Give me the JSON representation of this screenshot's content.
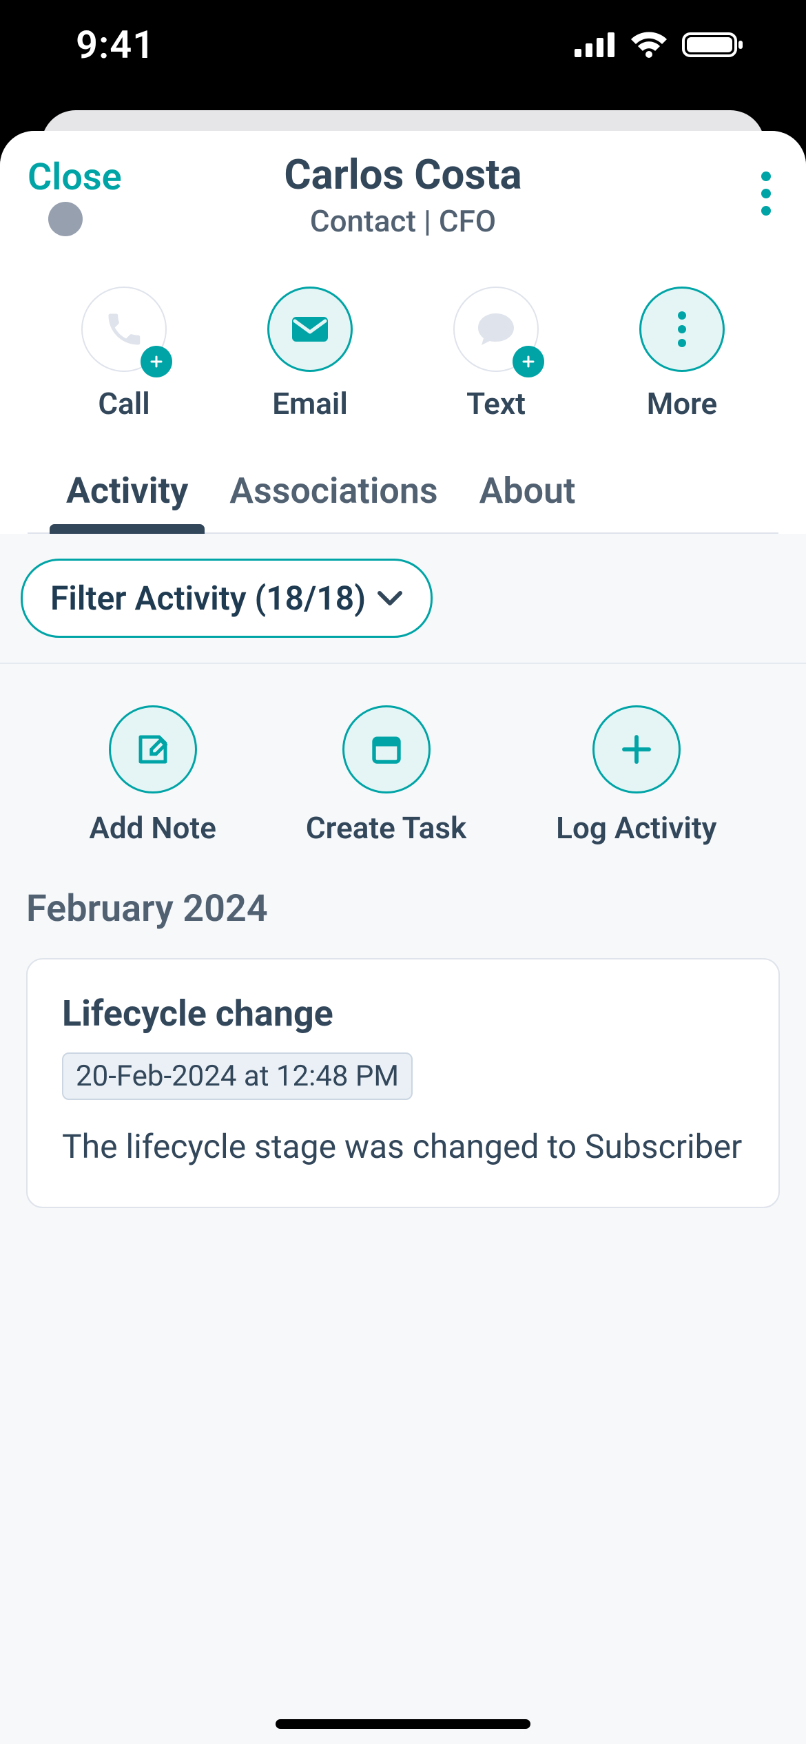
{
  "status": {
    "time": "9:41"
  },
  "header": {
    "close_label": "Close",
    "name": "Carlos Costa",
    "subtitle": "Contact | CFO"
  },
  "quick_actions": {
    "call": "Call",
    "email": "Email",
    "text": "Text",
    "more": "More"
  },
  "tabs": {
    "activity": "Activity",
    "associations": "Associations",
    "about": "About"
  },
  "filter": {
    "label": "Filter Activity (18/18)"
  },
  "secondary_actions": {
    "add_note": "Add Note",
    "create_task": "Create Task",
    "log_activity": "Log Activity"
  },
  "timeline": {
    "month": "February 2024",
    "card": {
      "title": "Lifecycle change",
      "datetime": "20-Feb-2024 at 12:48 PM",
      "body": "The lifecycle stage was changed to Subscriber"
    }
  }
}
